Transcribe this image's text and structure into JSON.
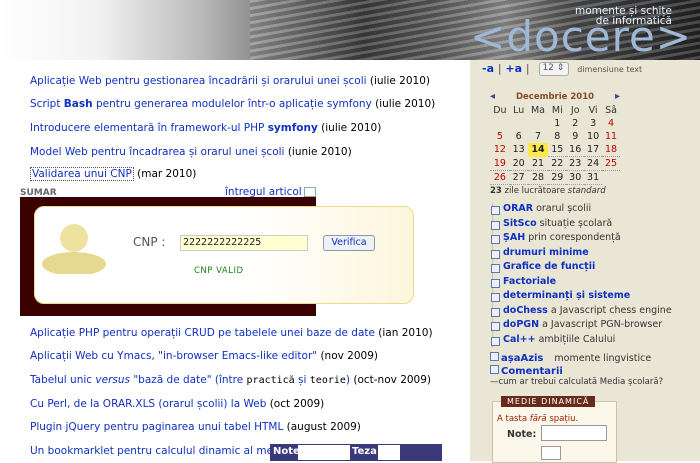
{
  "header": {
    "tagline_1": "momente și schițe",
    "tagline_2": "de informatică",
    "logo": "<docere>"
  },
  "articles": [
    {
      "text": "Aplicație Web pentru gestionarea încadrării și orarului unei școli",
      "date": "(iulie 2010)"
    },
    {
      "pre": "Script ",
      "bold": "Bash",
      "post": " pentru generarea modulelor într-o aplicație symfony",
      "date": "(iulie 2010)"
    },
    {
      "pre": "Introducere elementară în framework-ul PHP ",
      "bold": "symfony",
      "date": "(iulie 2010)"
    },
    {
      "text": "Model Web pentru încadrarea și orarul unei școli",
      "date": "(iunie 2010)"
    },
    {
      "text": "Validarea unui CNP",
      "date": "(mar 2010)"
    }
  ],
  "summary": {
    "label": "SUMAR",
    "full_link": "întregul articol"
  },
  "cnp_demo": {
    "label": "CNP :",
    "value": "2222222222225",
    "button": "Verifica",
    "status": "CNP VALID"
  },
  "more_articles": [
    {
      "text": "Aplicație PHP pentru operații CRUD pe tabelele unei baze de date",
      "date": "(ian 2010)"
    },
    {
      "text": "Aplicații Web cu Ymacs, \"in-browser Emacs-like editor\"",
      "date": "(nov 2009)"
    },
    {
      "t1": "Tabelul unic ",
      "t2": "versus",
      "t3": " \"bază de date\" (între ",
      "t4": "practică",
      "t5": " și ",
      "t6": "teorie",
      "t7": ")",
      "date": "(oct-nov 2009)"
    },
    {
      "text": "Cu Perl, de la ORAR.XLS (orarul școlii) la Web",
      "date": "(oct 2009)"
    },
    {
      "text": "Plugin jQuery pentru paginarea unui tabel HTML",
      "date": "(august 2009)"
    },
    {
      "text": "Un bookmarklet pentru calculul dinamic al mediei șc"
    }
  ],
  "notes_bar": {
    "note": "Note",
    "teza": "Teza"
  },
  "text_controls": {
    "minus": "-a",
    "plus": "+a",
    "size": "12",
    "label": "dimensiune text"
  },
  "calendar": {
    "month": "Decembrie 2010",
    "prev": "◂",
    "next": "▸",
    "days": [
      "Du",
      "Lu",
      "Ma",
      "Mi",
      "Jo",
      "Vi",
      "Sâ"
    ],
    "weeks": [
      [
        "",
        "",
        "",
        "1",
        "2",
        "3",
        "4"
      ],
      [
        "5",
        "6",
        "7",
        "8",
        "9",
        "10",
        "11"
      ],
      [
        "12",
        "13",
        "14",
        "15",
        "16",
        "17",
        "18"
      ],
      [
        "19",
        "20",
        "21",
        "22",
        "23",
        "24",
        "25"
      ],
      [
        "26",
        "27",
        "28",
        "29",
        "30",
        "31",
        ""
      ]
    ],
    "today": "14",
    "footer_num": "23",
    "footer_text": "zile lucrătoare",
    "footer_italic": "standard"
  },
  "menu": [
    {
      "name": "ORAR",
      "desc": "orarul școlii"
    },
    {
      "name": "SitSco",
      "desc": "situație școlară"
    },
    {
      "name": "ȘAH",
      "desc": "prin corespondență"
    },
    {
      "name": "drumuri minime",
      "desc": ""
    },
    {
      "name": "Grafice de funcții",
      "desc": ""
    },
    {
      "name": "Factoriale",
      "desc": ""
    },
    {
      "name": "determinanți și sisteme",
      "desc": ""
    },
    {
      "name": "doChess",
      "desc": "a Javascript chess engine"
    },
    {
      "name": "doPGN",
      "desc": "a Javascript PGN-browser"
    },
    {
      "name": "Cal++",
      "desc": "ambițiile Calului"
    }
  ],
  "extra": {
    "asa_azis": "așaAzis",
    "asa_desc": "momente lingvistice",
    "comentarii": "Comentarii",
    "comentarii_desc": "—cum ar trebui calculată Media școlară?"
  },
  "medie": {
    "title": "MEDIE DINAMICĂ",
    "fr1": "A tasta ",
    "fr_i": "fără",
    "fr2": " spațiu.",
    "note_label": "Note:"
  }
}
